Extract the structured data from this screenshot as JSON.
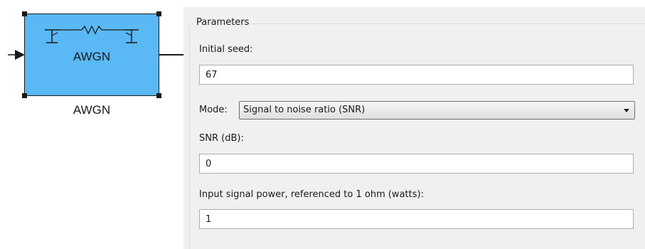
{
  "block": {
    "name": "AWGN",
    "caption": "AWGN",
    "icon": "awgn-channel-icon",
    "fill_color": "#5ab8f5"
  },
  "parameters": {
    "group_title": "Parameters",
    "initial_seed": {
      "label": "Initial seed:",
      "value": "67"
    },
    "mode": {
      "label": "Mode:",
      "value": "Signal to noise ratio  (SNR)"
    },
    "snr": {
      "label": "SNR (dB):",
      "value": "0"
    },
    "input_power": {
      "label": "Input signal power, referenced to 1 ohm (watts):",
      "value": "1"
    }
  }
}
